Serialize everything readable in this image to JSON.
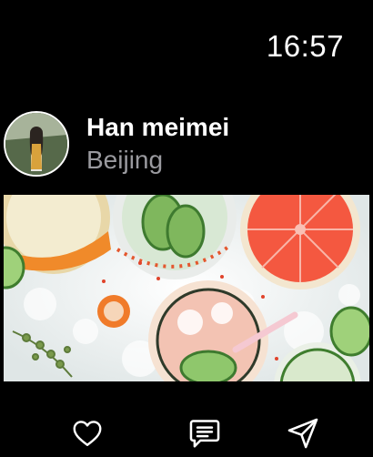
{
  "status_bar": {
    "time": "16:57"
  },
  "post": {
    "author_name": "Han meimei",
    "location": "Beijing",
    "photo_icon": "drinks-and-grapefruit-photo"
  },
  "actions": [
    {
      "icon": "heart-icon"
    },
    {
      "icon": "comment-icon"
    },
    {
      "icon": "send-icon"
    }
  ],
  "colors": {
    "background": "#000000",
    "text_primary": "#ffffff",
    "text_secondary": "#9a9a9f",
    "grapefruit": "#f2553f"
  }
}
